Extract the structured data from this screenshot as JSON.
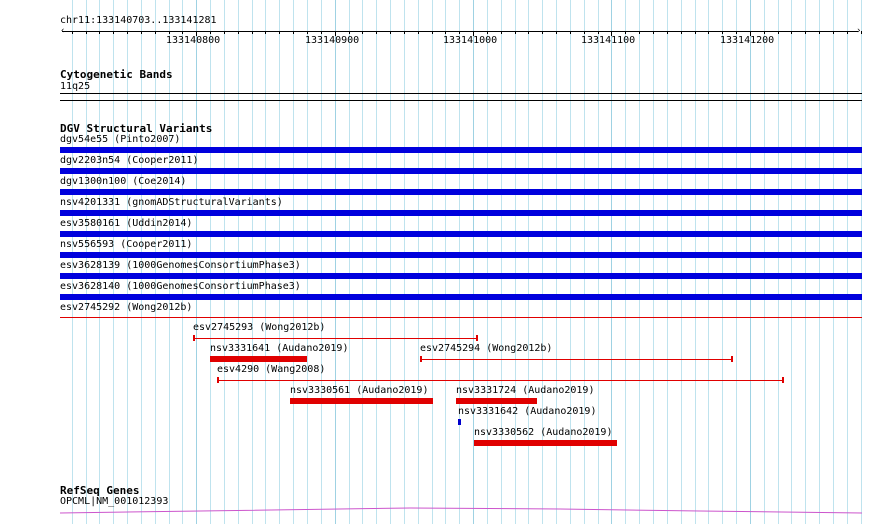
{
  "location": "chr11:133140703..133141281",
  "ruler": {
    "start": 133140703,
    "end": 133141281,
    "labels": [
      "133140800",
      "133140900",
      "133141000",
      "133141100",
      "133141200"
    ]
  },
  "cytogenetic": {
    "title": "Cytogenetic Bands",
    "band": "11q25"
  },
  "dgv": {
    "title": "DGV Structural Variants",
    "blue_rows": [
      {
        "label": "dgv54e55 (Pinto2007)"
      },
      {
        "label": "dgv2203n54 (Cooper2011)"
      },
      {
        "label": "dgv1300n100 (Coe2014)"
      },
      {
        "label": "nsv4201331 (gnomADStructuralVariants)"
      },
      {
        "label": "esv3580161 (Uddin2014)"
      },
      {
        "label": "nsv556593 (Cooper2011)"
      },
      {
        "label": "esv3628139 (1000GenomesConsortiumPhase3)"
      },
      {
        "label": "esv3628140 (1000GenomesConsortiumPhase3)"
      },
      {
        "label": "esv2745292 (Wong2012b)"
      }
    ],
    "features": [
      {
        "label": "esv2745293 (Wong2012b)",
        "start": 133140798,
        "end": 133141003,
        "style": "line",
        "color": "#e00000"
      },
      {
        "label": "nsv3331641 (Audano2019)",
        "start": 133140810,
        "end": 133140880,
        "style": "bar",
        "color": "#e00000"
      },
      {
        "label": "esv2745294 (Wong2012b)",
        "start": 133140962,
        "end": 133141187,
        "style": "line",
        "color": "#e00000"
      },
      {
        "label": "esv4290 (Wang2008)",
        "start": 133140815,
        "end": 133141224,
        "style": "line",
        "color": "#e00000"
      },
      {
        "label": "nsv3330561 (Audano2019)",
        "start": 133140868,
        "end": 133140971,
        "style": "bar",
        "color": "#e00000"
      },
      {
        "label": "nsv3331724 (Audano2019)",
        "start": 133140988,
        "end": 133141046,
        "style": "bar",
        "color": "#e00000"
      },
      {
        "label": "nsv3331642 (Audano2019)",
        "start": 133140989,
        "end": 133140991,
        "style": "bar",
        "color": "#0000cc"
      },
      {
        "label": "nsv3330562 (Audano2019)",
        "start": 133141001,
        "end": 133141104,
        "style": "bar",
        "color": "#e00000"
      }
    ]
  },
  "refseq": {
    "title": "RefSeq Genes",
    "gene": "OPCML|NM_001012393"
  },
  "colors": {
    "grid": "#bfe3ee",
    "variant_blue": "#0000dd",
    "variant_red": "#e00000",
    "gene_line": "#cc55cc"
  }
}
